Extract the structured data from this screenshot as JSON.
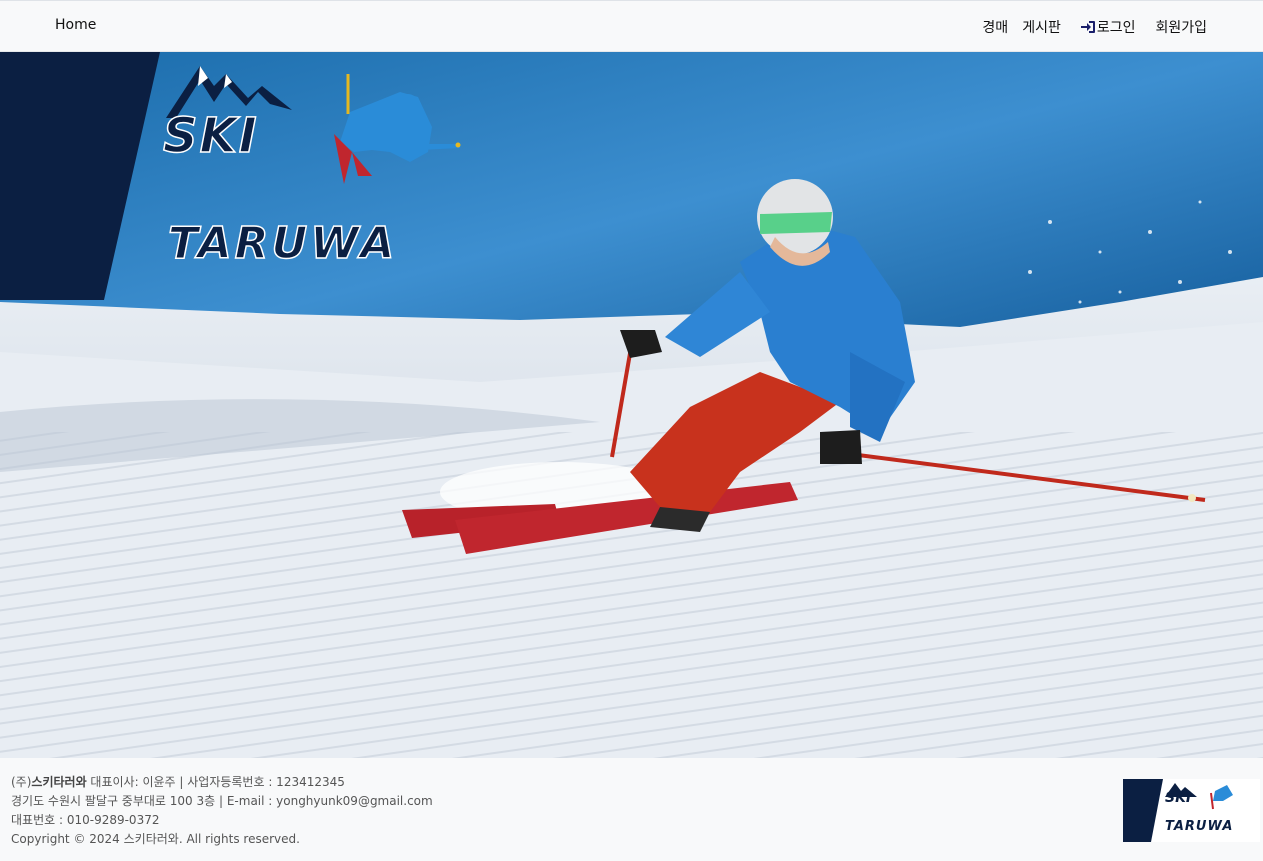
{
  "nav": {
    "home": "Home",
    "auction": "경매",
    "board": "게시판",
    "login": "로그인",
    "signup": "회원가입"
  },
  "brand": {
    "line1": "SKI",
    "line2": "TARUWA"
  },
  "footer": {
    "company_prefix": "(주)",
    "company_name": "스키타러와",
    "ceo_info": " 대표이사: 이윤주 | 사업자등록번호 : 123412345",
    "address": "경기도 수원시 팔달구 중부대로 100 3층 | E-mail : yonghyunk09@gmail.com",
    "phone": "대표번호 : 010-9289-0372",
    "copyright": "Copyright © 2024 스키타러와. All rights reserved.",
    "logo_line1": "SKI",
    "logo_line2": "TARUWA"
  },
  "colors": {
    "navy": "#0b1f42",
    "sky": "#1e6fb3",
    "jacket": "#2a7fd0",
    "pants": "#c8321d"
  },
  "icons": {
    "login": "sign-in-icon"
  }
}
